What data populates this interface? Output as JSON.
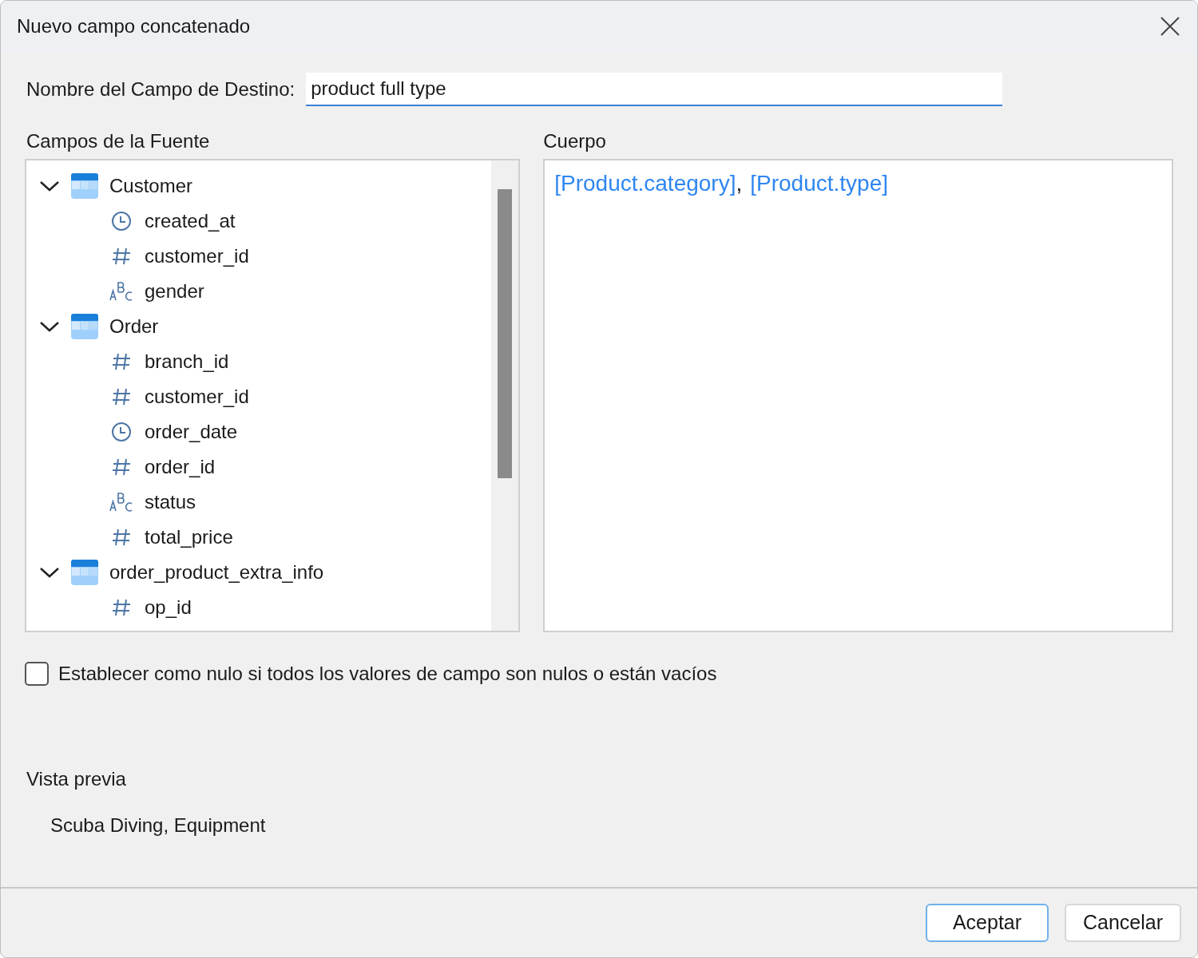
{
  "window": {
    "title": "Nuevo campo concatenado"
  },
  "target_field": {
    "label": "Nombre del Campo de Destino:",
    "value": "product full type"
  },
  "source_fields": {
    "label": "Campos de la Fuente",
    "tables": [
      {
        "name": "Customer",
        "expanded": true,
        "children": [
          {
            "name": "created_at",
            "kind": "time"
          },
          {
            "name": "customer_id",
            "kind": "number"
          },
          {
            "name": "gender",
            "kind": "text"
          }
        ]
      },
      {
        "name": "Order",
        "expanded": true,
        "children": [
          {
            "name": "branch_id",
            "kind": "number"
          },
          {
            "name": "customer_id",
            "kind": "number"
          },
          {
            "name": "order_date",
            "kind": "time"
          },
          {
            "name": "order_id",
            "kind": "number"
          },
          {
            "name": "status",
            "kind": "text"
          },
          {
            "name": "total_price",
            "kind": "number"
          }
        ]
      },
      {
        "name": "order_product_extra_info",
        "expanded": true,
        "children": [
          {
            "name": "op_id",
            "kind": "number"
          }
        ]
      }
    ]
  },
  "body": {
    "label": "Cuerpo",
    "tokens": [
      {
        "text": "[Product.category]",
        "kind": "field"
      },
      {
        "text": ",",
        "kind": "plain"
      },
      {
        "text": "[Product.type]",
        "kind": "field"
      }
    ]
  },
  "null_option": {
    "label": "Establecer como nulo si todos los valores de campo son nulos o están vacíos",
    "checked": false
  },
  "preview": {
    "label": "Vista previa",
    "value": "Scuba Diving, Equipment"
  },
  "buttons": [
    {
      "label": "Aceptar",
      "default": true
    },
    {
      "label": "Cancelar",
      "default": false
    }
  ]
}
